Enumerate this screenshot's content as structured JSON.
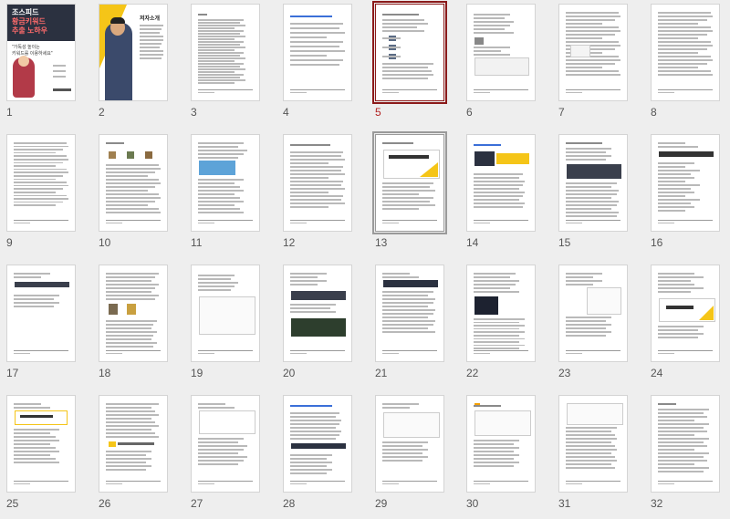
{
  "view": {
    "selected_page": "5",
    "focused_page": "13"
  },
  "cover": {
    "line1": "조스피드",
    "line2": "황금키워드",
    "line3": "추출 노하우",
    "subtitle1": "\"가독성 높이는",
    "subtitle2": "키워드를 이용하세요\""
  },
  "author_page": {
    "name_label": "저자소개"
  },
  "pages": [
    {
      "number": "1"
    },
    {
      "number": "2"
    },
    {
      "number": "3"
    },
    {
      "number": "4"
    },
    {
      "number": "5"
    },
    {
      "number": "6"
    },
    {
      "number": "7"
    },
    {
      "number": "8"
    },
    {
      "number": "9"
    },
    {
      "number": "10"
    },
    {
      "number": "11"
    },
    {
      "number": "12"
    },
    {
      "number": "13"
    },
    {
      "number": "14"
    },
    {
      "number": "15"
    },
    {
      "number": "16"
    },
    {
      "number": "17"
    },
    {
      "number": "18"
    },
    {
      "number": "19"
    },
    {
      "number": "20"
    },
    {
      "number": "21"
    },
    {
      "number": "22"
    },
    {
      "number": "23"
    },
    {
      "number": "24"
    },
    {
      "number": "25"
    },
    {
      "number": "26"
    },
    {
      "number": "27"
    },
    {
      "number": "28"
    },
    {
      "number": "29"
    },
    {
      "number": "30"
    },
    {
      "number": "31"
    },
    {
      "number": "32"
    }
  ],
  "colors": {
    "selected_border": "#8b1a1a",
    "selected_number": "#b22222",
    "accent_yellow": "#f5c518",
    "dark_block": "#2b3140"
  }
}
